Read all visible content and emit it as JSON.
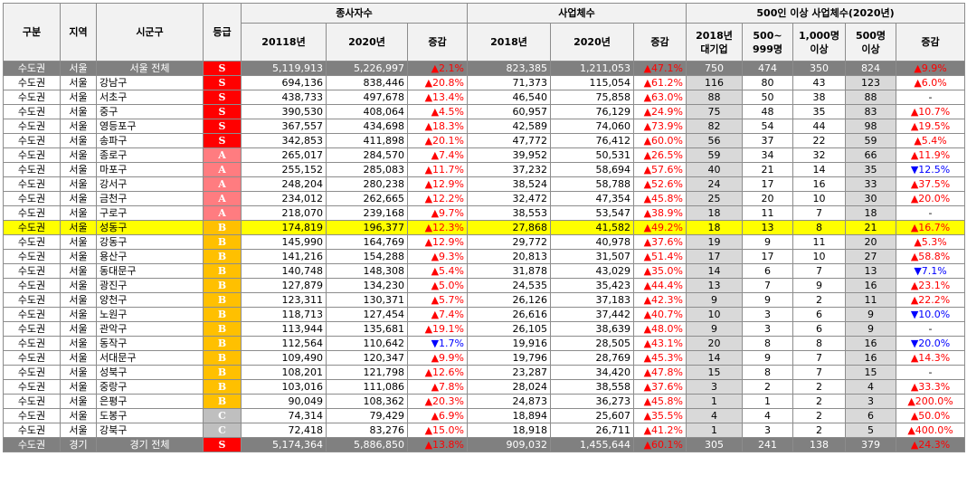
{
  "header": {
    "gubun": "구분",
    "region": "지역",
    "sigungu": "시군구",
    "grade": "등급",
    "employees": "종사자수",
    "businesses": "사업체수",
    "large": "500인 이상 사업체수(2020년)",
    "emp_2018": "20118년",
    "emp_2020": "2020년",
    "emp_change": "증감",
    "biz_2018": "2018년",
    "biz_2020": "2020년",
    "biz_change": "증감",
    "l_2018_a": "2018년",
    "l_2018_b": "대기업",
    "l_500_a": "500~",
    "l_500_b": "999명",
    "l_1000_a": "1,000명",
    "l_1000_b": "이상",
    "l_500up_a": "500명",
    "l_500up_b": "이상",
    "l_change": "증감"
  },
  "rows": [
    {
      "type": "total",
      "a": "수도권",
      "b": "서울",
      "c": "서울 전체",
      "grade": "S",
      "e18": "5,119,913",
      "e20": "5,226,997",
      "ec": "▲2.1%",
      "b18": "823,385",
      "b20": "1,211,053",
      "bc": "▲47.1%",
      "l1": "750",
      "l2": "474",
      "l3": "350",
      "l4": "824",
      "lc": "▲9.9%"
    },
    {
      "type": "row",
      "a": "수도권",
      "b": "서울",
      "c": "강남구",
      "grade": "S",
      "e18": "694,136",
      "e20": "838,446",
      "ec": "▲20.8%",
      "b18": "71,373",
      "b20": "115,054",
      "bc": "▲61.2%",
      "l1": "116",
      "l2": "80",
      "l3": "43",
      "l4": "123",
      "lc": "▲6.0%"
    },
    {
      "type": "row",
      "a": "수도권",
      "b": "서울",
      "c": "서초구",
      "grade": "S",
      "e18": "438,733",
      "e20": "497,678",
      "ec": "▲13.4%",
      "b18": "46,540",
      "b20": "75,858",
      "bc": "▲63.0%",
      "l1": "88",
      "l2": "50",
      "l3": "38",
      "l4": "88",
      "lc": "-"
    },
    {
      "type": "row",
      "a": "수도권",
      "b": "서울",
      "c": "중구",
      "grade": "S",
      "e18": "390,530",
      "e20": "408,064",
      "ec": "▲4.5%",
      "b18": "60,957",
      "b20": "76,129",
      "bc": "▲24.9%",
      "l1": "75",
      "l2": "48",
      "l3": "35",
      "l4": "83",
      "lc": "▲10.7%"
    },
    {
      "type": "row",
      "a": "수도권",
      "b": "서울",
      "c": "영등포구",
      "grade": "S",
      "e18": "367,557",
      "e20": "434,698",
      "ec": "▲18.3%",
      "b18": "42,589",
      "b20": "74,060",
      "bc": "▲73.9%",
      "l1": "82",
      "l2": "54",
      "l3": "44",
      "l4": "98",
      "lc": "▲19.5%"
    },
    {
      "type": "row",
      "a": "수도권",
      "b": "서울",
      "c": "송파구",
      "grade": "S",
      "e18": "342,853",
      "e20": "411,898",
      "ec": "▲20.1%",
      "b18": "47,772",
      "b20": "76,412",
      "bc": "▲60.0%",
      "l1": "56",
      "l2": "37",
      "l3": "22",
      "l4": "59",
      "lc": "▲5.4%"
    },
    {
      "type": "row",
      "a": "수도권",
      "b": "서울",
      "c": "종로구",
      "grade": "A",
      "e18": "265,017",
      "e20": "284,570",
      "ec": "▲7.4%",
      "b18": "39,952",
      "b20": "50,531",
      "bc": "▲26.5%",
      "l1": "59",
      "l2": "34",
      "l3": "32",
      "l4": "66",
      "lc": "▲11.9%"
    },
    {
      "type": "row",
      "a": "수도권",
      "b": "서울",
      "c": "마포구",
      "grade": "A",
      "e18": "255,152",
      "e20": "285,083",
      "ec": "▲11.7%",
      "b18": "37,232",
      "b20": "58,694",
      "bc": "▲57.6%",
      "l1": "40",
      "l2": "21",
      "l3": "14",
      "l4": "35",
      "lc": "▼12.5%"
    },
    {
      "type": "row",
      "a": "수도권",
      "b": "서울",
      "c": "강서구",
      "grade": "A",
      "e18": "248,204",
      "e20": "280,238",
      "ec": "▲12.9%",
      "b18": "38,524",
      "b20": "58,788",
      "bc": "▲52.6%",
      "l1": "24",
      "l2": "17",
      "l3": "16",
      "l4": "33",
      "lc": "▲37.5%"
    },
    {
      "type": "row",
      "a": "수도권",
      "b": "서울",
      "c": "금천구",
      "grade": "A",
      "e18": "234,012",
      "e20": "262,665",
      "ec": "▲12.2%",
      "b18": "32,472",
      "b20": "47,354",
      "bc": "▲45.8%",
      "l1": "25",
      "l2": "20",
      "l3": "10",
      "l4": "30",
      "lc": "▲20.0%"
    },
    {
      "type": "row",
      "a": "수도권",
      "b": "서울",
      "c": "구로구",
      "grade": "A",
      "e18": "218,070",
      "e20": "239,168",
      "ec": "▲9.7%",
      "b18": "38,553",
      "b20": "53,547",
      "bc": "▲38.9%",
      "l1": "18",
      "l2": "11",
      "l3": "7",
      "l4": "18",
      "lc": "-"
    },
    {
      "type": "hl",
      "a": "수도권",
      "b": "서울",
      "c": "성동구",
      "grade": "B",
      "e18": "174,819",
      "e20": "196,377",
      "ec": "▲12.3%",
      "b18": "27,868",
      "b20": "41,582",
      "bc": "▲49.2%",
      "l1": "18",
      "l2": "13",
      "l3": "8",
      "l4": "21",
      "lc": "▲16.7%"
    },
    {
      "type": "row",
      "a": "수도권",
      "b": "서울",
      "c": "강동구",
      "grade": "B",
      "e18": "145,990",
      "e20": "164,769",
      "ec": "▲12.9%",
      "b18": "29,772",
      "b20": "40,978",
      "bc": "▲37.6%",
      "l1": "19",
      "l2": "9",
      "l3": "11",
      "l4": "20",
      "lc": "▲5.3%"
    },
    {
      "type": "row",
      "a": "수도권",
      "b": "서울",
      "c": "용산구",
      "grade": "B",
      "e18": "141,216",
      "e20": "154,288",
      "ec": "▲9.3%",
      "b18": "20,813",
      "b20": "31,507",
      "bc": "▲51.4%",
      "l1": "17",
      "l2": "17",
      "l3": "10",
      "l4": "27",
      "lc": "▲58.8%"
    },
    {
      "type": "row",
      "a": "수도권",
      "b": "서울",
      "c": "동대문구",
      "grade": "B",
      "e18": "140,748",
      "e20": "148,308",
      "ec": "▲5.4%",
      "b18": "31,878",
      "b20": "43,029",
      "bc": "▲35.0%",
      "l1": "14",
      "l2": "6",
      "l3": "7",
      "l4": "13",
      "lc": "▼7.1%"
    },
    {
      "type": "row",
      "a": "수도권",
      "b": "서울",
      "c": "광진구",
      "grade": "B",
      "e18": "127,879",
      "e20": "134,230",
      "ec": "▲5.0%",
      "b18": "24,535",
      "b20": "35,423",
      "bc": "▲44.4%",
      "l1": "13",
      "l2": "7",
      "l3": "9",
      "l4": "16",
      "lc": "▲23.1%"
    },
    {
      "type": "row",
      "a": "수도권",
      "b": "서울",
      "c": "양천구",
      "grade": "B",
      "e18": "123,311",
      "e20": "130,371",
      "ec": "▲5.7%",
      "b18": "26,126",
      "b20": "37,183",
      "bc": "▲42.3%",
      "l1": "9",
      "l2": "9",
      "l3": "2",
      "l4": "11",
      "lc": "▲22.2%"
    },
    {
      "type": "row",
      "a": "수도권",
      "b": "서울",
      "c": "노원구",
      "grade": "B",
      "e18": "118,713",
      "e20": "127,454",
      "ec": "▲7.4%",
      "b18": "26,616",
      "b20": "37,442",
      "bc": "▲40.7%",
      "l1": "10",
      "l2": "3",
      "l3": "6",
      "l4": "9",
      "lc": "▼10.0%"
    },
    {
      "type": "row",
      "a": "수도권",
      "b": "서울",
      "c": "관악구",
      "grade": "B",
      "e18": "113,944",
      "e20": "135,681",
      "ec": "▲19.1%",
      "b18": "26,105",
      "b20": "38,639",
      "bc": "▲48.0%",
      "l1": "9",
      "l2": "3",
      "l3": "6",
      "l4": "9",
      "lc": "-"
    },
    {
      "type": "row",
      "a": "수도권",
      "b": "서울",
      "c": "동작구",
      "grade": "B",
      "e18": "112,564",
      "e20": "110,642",
      "ec": "▼1.7%",
      "b18": "19,916",
      "b20": "28,505",
      "bc": "▲43.1%",
      "l1": "20",
      "l2": "8",
      "l3": "8",
      "l4": "16",
      "lc": "▼20.0%"
    },
    {
      "type": "row",
      "a": "수도권",
      "b": "서울",
      "c": "서대문구",
      "grade": "B",
      "e18": "109,490",
      "e20": "120,347",
      "ec": "▲9.9%",
      "b18": "19,796",
      "b20": "28,769",
      "bc": "▲45.3%",
      "l1": "14",
      "l2": "9",
      "l3": "7",
      "l4": "16",
      "lc": "▲14.3%"
    },
    {
      "type": "row",
      "a": "수도권",
      "b": "서울",
      "c": "성북구",
      "grade": "B",
      "e18": "108,201",
      "e20": "121,798",
      "ec": "▲12.6%",
      "b18": "23,287",
      "b20": "34,420",
      "bc": "▲47.8%",
      "l1": "15",
      "l2": "8",
      "l3": "7",
      "l4": "15",
      "lc": "-"
    },
    {
      "type": "row",
      "a": "수도권",
      "b": "서울",
      "c": "중랑구",
      "grade": "B",
      "e18": "103,016",
      "e20": "111,086",
      "ec": "▲7.8%",
      "b18": "28,024",
      "b20": "38,558",
      "bc": "▲37.6%",
      "l1": "3",
      "l2": "2",
      "l3": "2",
      "l4": "4",
      "lc": "▲33.3%"
    },
    {
      "type": "row",
      "a": "수도권",
      "b": "서울",
      "c": "은평구",
      "grade": "B",
      "e18": "90,049",
      "e20": "108,362",
      "ec": "▲20.3%",
      "b18": "24,873",
      "b20": "36,273",
      "bc": "▲45.8%",
      "l1": "1",
      "l2": "1",
      "l3": "2",
      "l4": "3",
      "lc": "▲200.0%"
    },
    {
      "type": "row",
      "a": "수도권",
      "b": "서울",
      "c": "도봉구",
      "grade": "C",
      "e18": "74,314",
      "e20": "79,429",
      "ec": "▲6.9%",
      "b18": "18,894",
      "b20": "25,607",
      "bc": "▲35.5%",
      "l1": "4",
      "l2": "4",
      "l3": "2",
      "l4": "6",
      "lc": "▲50.0%"
    },
    {
      "type": "row",
      "a": "수도권",
      "b": "서울",
      "c": "강북구",
      "grade": "C",
      "e18": "72,418",
      "e20": "83,276",
      "ec": "▲15.0%",
      "b18": "18,918",
      "b20": "26,711",
      "bc": "▲41.2%",
      "l1": "1",
      "l2": "3",
      "l3": "2",
      "l4": "5",
      "lc": "▲400.0%"
    },
    {
      "type": "total",
      "a": "수도권",
      "b": "경기",
      "c": "경기 전체",
      "grade": "S",
      "e18": "5,174,364",
      "e20": "5,886,850",
      "ec": "▲13.8%",
      "b18": "909,032",
      "b20": "1,455,644",
      "bc": "▲60.1%",
      "l1": "305",
      "l2": "241",
      "l3": "138",
      "l4": "379",
      "lc": "▲24.3%"
    }
  ]
}
